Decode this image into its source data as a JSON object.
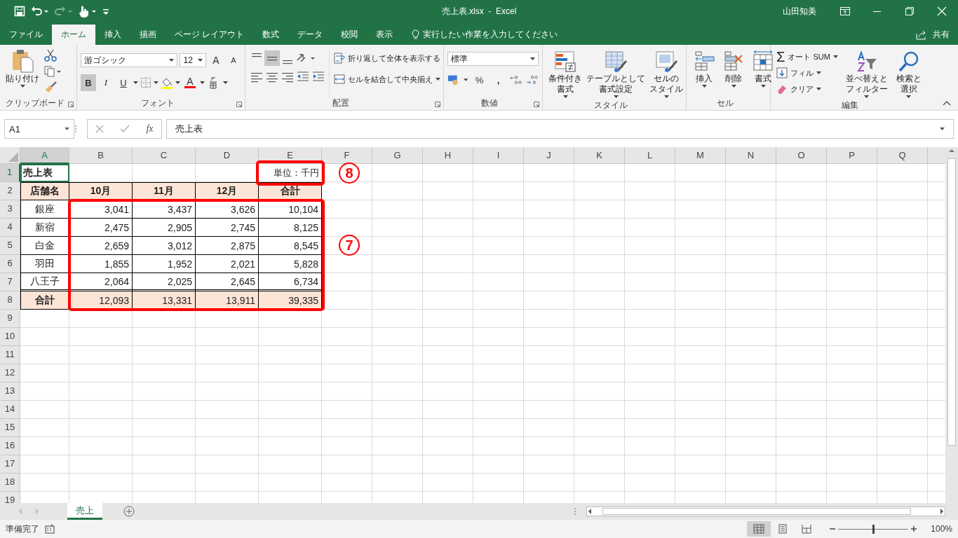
{
  "title_bar": {
    "title": "売上表.xlsx  -  Excel",
    "user": "山田知美"
  },
  "ribbon_tabs": [
    {
      "label": "ファイル",
      "selected": false
    },
    {
      "label": "ホーム",
      "selected": true
    },
    {
      "label": "挿入",
      "selected": false
    },
    {
      "label": "描画",
      "selected": false
    },
    {
      "label": "ページ レイアウト",
      "selected": false
    },
    {
      "label": "数式",
      "selected": false
    },
    {
      "label": "データ",
      "selected": false
    },
    {
      "label": "校閲",
      "selected": false
    },
    {
      "label": "表示",
      "selected": false
    }
  ],
  "tell_me": "実行したい作業を入力してください",
  "share": "共有",
  "clipboard": {
    "paste": "貼り付け",
    "label": "クリップボード"
  },
  "font": {
    "name": "游ゴシック",
    "size": "12",
    "grow": "A",
    "shrink": "A",
    "font_color": "A",
    "label": "フォント",
    "styles": [
      {
        "label": "B",
        "selected": true
      },
      {
        "label": "I",
        "selected": false
      },
      {
        "label": "U",
        "selected": false
      }
    ]
  },
  "alignment": {
    "wrap": "折り返して全体を表示する",
    "merge": "セルを結合して中央揃え",
    "label": "配置",
    "vertical": [
      {
        "selected": false
      },
      {
        "selected": true
      },
      {
        "selected": false
      }
    ]
  },
  "number": {
    "format": "標準",
    "percent": "%",
    "comma": ",",
    "label": "数値"
  },
  "styles": {
    "label": "スタイル",
    "buttons": [
      {
        "lines": [
          "条件付き",
          "書式"
        ]
      },
      {
        "lines": [
          "テーブルとして",
          "書式設定"
        ]
      },
      {
        "lines": [
          "セルの",
          "スタイル"
        ]
      }
    ]
  },
  "cells": {
    "buttons": [
      "挿入",
      "削除",
      "書式"
    ],
    "label": "セル"
  },
  "editing": {
    "sigma": "Σ",
    "autosum": "オート SUM",
    "fill": "フィル",
    "clear": "クリア",
    "label": "編集",
    "buttons": [
      {
        "lines": [
          "並べ替えと",
          "フィルター"
        ]
      },
      {
        "lines": [
          "検索と",
          "選択"
        ]
      }
    ]
  },
  "formula_bar": {
    "name_box": "A1",
    "fx": "fx",
    "value": "売上表"
  },
  "sheet": {
    "columns": [
      {
        "label": "A",
        "selected": true
      },
      {
        "label": "B",
        "selected": false
      },
      {
        "label": "C",
        "selected": false
      },
      {
        "label": "D",
        "selected": false
      },
      {
        "label": "E",
        "selected": false
      },
      {
        "label": "F",
        "selected": false
      },
      {
        "label": "G",
        "selected": false
      },
      {
        "label": "H",
        "selected": false
      },
      {
        "label": "I",
        "selected": false
      },
      {
        "label": "J",
        "selected": false
      },
      {
        "label": "K",
        "selected": false
      },
      {
        "label": "L",
        "selected": false
      },
      {
        "label": "M",
        "selected": false
      },
      {
        "label": "N",
        "selected": false
      },
      {
        "label": "O",
        "selected": false
      },
      {
        "label": "P",
        "selected": false
      },
      {
        "label": "Q",
        "selected": false
      }
    ],
    "rows": [
      {
        "number": "1",
        "selected": true,
        "kind": "title",
        "cells": [
          "売上表",
          null,
          null,
          null,
          "単位：千円"
        ]
      },
      {
        "number": "2",
        "selected": false,
        "kind": "header",
        "cells": [
          "店舗名",
          "10月",
          "11月",
          "12月",
          "合計"
        ]
      },
      {
        "number": "3",
        "selected": false,
        "kind": "data",
        "cells": [
          "銀座",
          "3,041",
          "3,437",
          "3,626",
          "10,104"
        ]
      },
      {
        "number": "4",
        "selected": false,
        "kind": "data",
        "cells": [
          "新宿",
          "2,475",
          "2,905",
          "2,745",
          "8,125"
        ]
      },
      {
        "number": "5",
        "selected": false,
        "kind": "data",
        "cells": [
          "白金",
          "2,659",
          "3,012",
          "2,875",
          "8,545"
        ]
      },
      {
        "number": "6",
        "selected": false,
        "kind": "data",
        "cells": [
          "羽田",
          "1,855",
          "1,952",
          "2,021",
          "5,828"
        ]
      },
      {
        "number": "7",
        "selected": false,
        "kind": "data",
        "cells": [
          "八王子",
          "2,064",
          "2,025",
          "2,645",
          "6,734"
        ]
      },
      {
        "number": "8",
        "selected": false,
        "kind": "total",
        "cells": [
          "合計",
          "12,093",
          "13,331",
          "13,911",
          "39,335"
        ]
      },
      {
        "number": "9",
        "selected": false,
        "kind": "empty"
      },
      {
        "number": "10",
        "selected": false,
        "kind": "empty"
      },
      {
        "number": "11",
        "selected": false,
        "kind": "empty"
      },
      {
        "number": "12",
        "selected": false,
        "kind": "empty"
      },
      {
        "number": "13",
        "selected": false,
        "kind": "empty"
      },
      {
        "number": "14",
        "selected": false,
        "kind": "empty"
      },
      {
        "number": "15",
        "selected": false,
        "kind": "empty"
      },
      {
        "number": "16",
        "selected": false,
        "kind": "empty"
      },
      {
        "number": "17",
        "selected": false,
        "kind": "empty"
      },
      {
        "number": "18",
        "selected": false,
        "kind": "empty"
      },
      {
        "number": "19",
        "selected": false,
        "kind": "empty"
      }
    ]
  },
  "annotations": [
    {
      "number": "8"
    },
    {
      "number": "7"
    }
  ],
  "sheet_tabs": [
    {
      "label": "売上",
      "selected": true
    }
  ],
  "status_bar": {
    "status": "準備完了",
    "views": [
      {
        "selected": true
      },
      {
        "selected": false
      },
      {
        "selected": false
      }
    ],
    "zoom": {
      "level": 0.5,
      "reading": "100%"
    }
  }
}
